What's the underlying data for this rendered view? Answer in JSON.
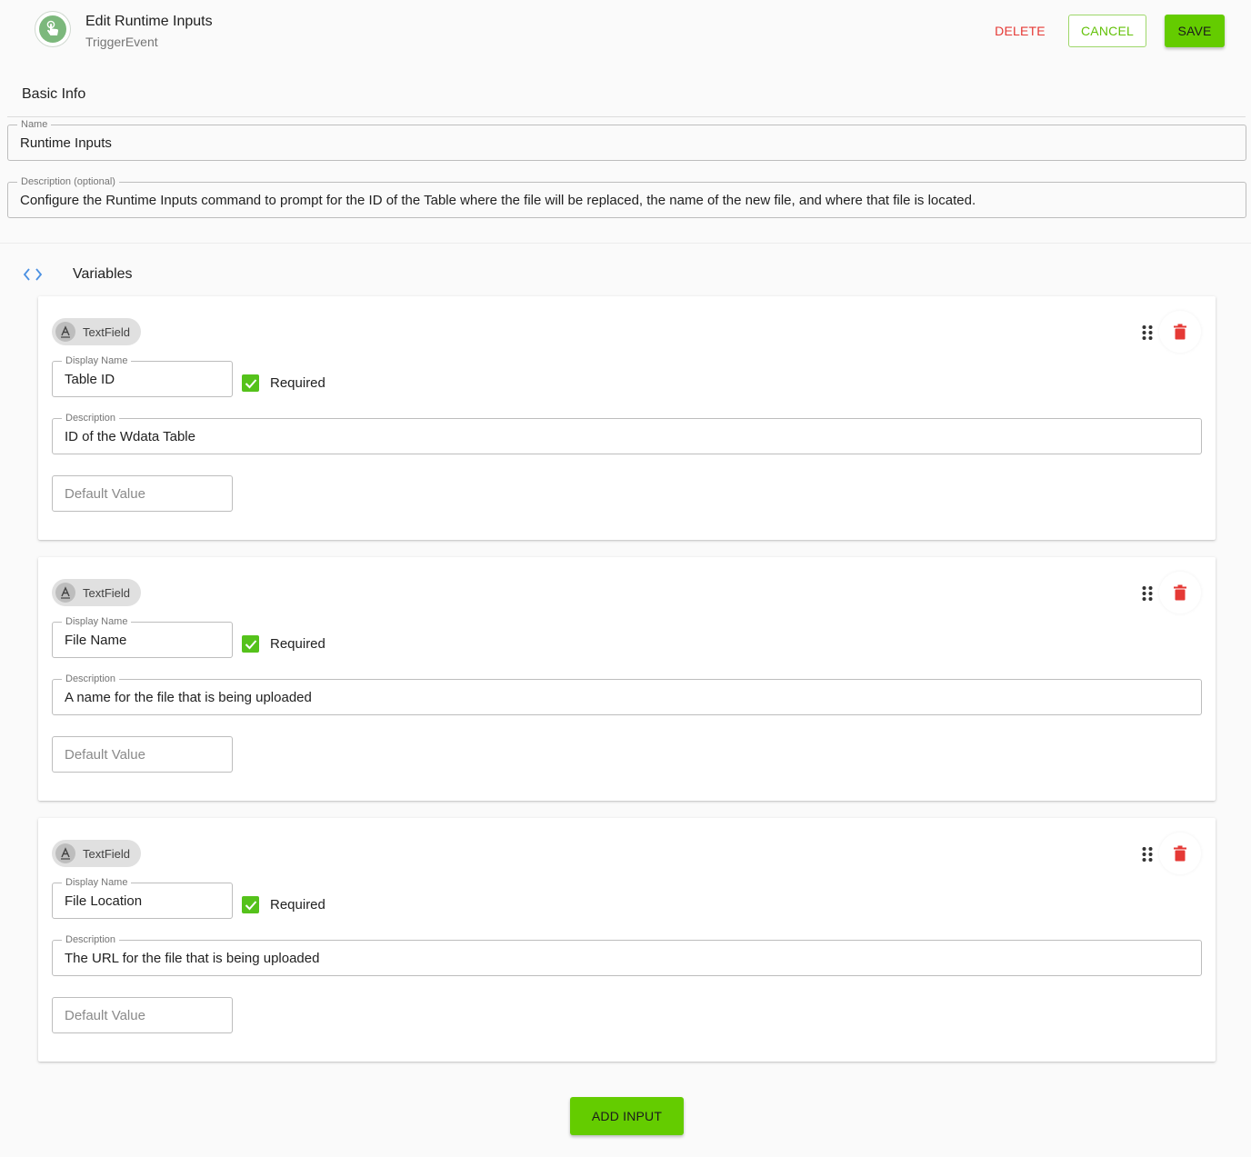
{
  "header": {
    "title": "Edit Runtime Inputs",
    "subtitle": "TriggerEvent",
    "icon": "touch-hand-icon"
  },
  "actions": {
    "delete_label": "DELETE",
    "cancel_label": "CANCEL",
    "save_label": "SAVE"
  },
  "basic_info": {
    "section_title": "Basic Info",
    "name_label": "Name",
    "name_value": "Runtime Inputs",
    "description_label": "Description (optional)",
    "description_value": "Configure the Runtime Inputs command to prompt for the ID of the Table where the file will be replaced, the name of the new file, and where that file is located."
  },
  "variables": {
    "section_title": "Variables",
    "items": [
      {
        "type": "TextField",
        "display_name_label": "Display Name",
        "display_name": "Table ID",
        "required_label": "Required",
        "required": true,
        "description_label": "Description",
        "description": "ID of the Wdata Table",
        "default_placeholder": "Default Value"
      },
      {
        "type": "TextField",
        "display_name_label": "Display Name",
        "display_name": "File Name",
        "required_label": "Required",
        "required": true,
        "description_label": "Description",
        "description": "A name for the file that is being uploaded",
        "default_placeholder": "Default Value"
      },
      {
        "type": "TextField",
        "display_name_label": "Display Name",
        "display_name": "File Location",
        "required_label": "Required",
        "required": true,
        "description_label": "Description",
        "description": "The URL for the file that is being uploaded",
        "default_placeholder": "Default Value"
      }
    ]
  },
  "add_input_label": "ADD INPUT",
  "colors": {
    "primary": "#64cc00",
    "danger": "#e53935",
    "link_blue": "#4a90e2"
  }
}
